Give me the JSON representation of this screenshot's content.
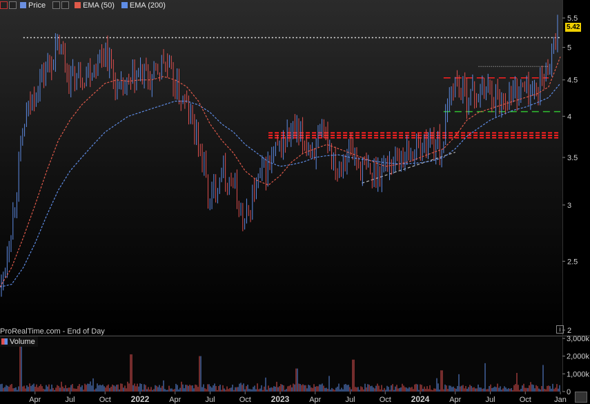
{
  "legend": {
    "price_label": "Price",
    "ema50_label": "EMA (50)",
    "ema200_label": "EMA (200)"
  },
  "credit": "ProRealTime.com - End of Day",
  "volume_label": "Volume",
  "last_value": "5.42",
  "colors": {
    "background": "#000000",
    "up_candle": "#5f8de6",
    "down_candle": "#e05050",
    "ema50": "#e05a4a",
    "ema200": "#5f8de6",
    "resistance": "#ff2020",
    "highlight": "#f0d000",
    "support_green": "#30c030"
  },
  "icons": {
    "window_buttons": [
      "close-icon",
      "minimize-icon",
      "list-icon",
      "maximize-icon"
    ],
    "info": "info-icon"
  },
  "chart_data": [
    {
      "type": "candlestick",
      "panel": "price",
      "series": [
        {
          "name": "Price"
        },
        {
          "name": "EMA (50)"
        },
        {
          "name": "EMA (200)"
        }
      ],
      "x_ticks": [
        "Apr",
        "Jul",
        "Oct",
        "2022",
        "Apr",
        "Jul",
        "Oct",
        "2023",
        "Apr",
        "Jul",
        "Oct",
        "2024",
        "Apr",
        "Jul",
        "Oct",
        "Jan"
      ],
      "y_ticks": [
        2,
        2.5,
        3,
        3.5,
        4,
        4.5,
        5,
        5.5
      ],
      "ylim": [
        2,
        5.6
      ],
      "y_scale": "log",
      "x": [
        "2021-01",
        "2021-02",
        "2021-03",
        "2021-04",
        "2021-05",
        "2021-06",
        "2021-07",
        "2021-08",
        "2021-09",
        "2021-10",
        "2021-11",
        "2021-12",
        "2022-01",
        "2022-02",
        "2022-03",
        "2022-04",
        "2022-05",
        "2022-06",
        "2022-07",
        "2022-08",
        "2022-09",
        "2022-10",
        "2022-11",
        "2022-12",
        "2023-01",
        "2023-02",
        "2023-03",
        "2023-04",
        "2023-05",
        "2023-06",
        "2023-07",
        "2023-08",
        "2023-09",
        "2023-10",
        "2023-11",
        "2023-12",
        "2024-01",
        "2024-02",
        "2024-03",
        "2024-04",
        "2024-05",
        "2024-06",
        "2024-07",
        "2024-08",
        "2024-09",
        "2024-10",
        "2024-11",
        "2024-12",
        "2025-01"
      ],
      "close": [
        2.3,
        2.9,
        3.9,
        4.4,
        4.7,
        5.0,
        4.5,
        4.6,
        4.7,
        5.0,
        4.3,
        4.4,
        4.6,
        4.5,
        4.8,
        4.4,
        4.1,
        3.7,
        3.0,
        3.4,
        3.2,
        2.8,
        3.2,
        3.4,
        3.6,
        3.8,
        3.7,
        3.6,
        3.75,
        3.4,
        3.6,
        3.4,
        3.3,
        3.4,
        3.5,
        3.55,
        3.6,
        3.7,
        3.6,
        4.5,
        4.3,
        4.3,
        4.4,
        4.2,
        4.3,
        4.4,
        4.3,
        4.6,
        5.3
      ],
      "ema50": [
        2.3,
        2.45,
        2.7,
        3.0,
        3.35,
        3.7,
        3.95,
        4.15,
        4.3,
        4.45,
        4.5,
        4.48,
        4.5,
        4.5,
        4.55,
        4.5,
        4.4,
        4.2,
        3.9,
        3.7,
        3.55,
        3.35,
        3.25,
        3.2,
        3.3,
        3.45,
        3.55,
        3.6,
        3.65,
        3.6,
        3.55,
        3.5,
        3.45,
        3.4,
        3.42,
        3.45,
        3.5,
        3.55,
        3.6,
        3.75,
        3.95,
        4.05,
        4.1,
        4.15,
        4.2,
        4.25,
        4.3,
        4.4,
        4.85
      ],
      "ema200": [
        2.3,
        2.32,
        2.45,
        2.65,
        2.9,
        3.15,
        3.35,
        3.5,
        3.65,
        3.8,
        3.9,
        4.0,
        4.05,
        4.1,
        4.15,
        4.2,
        4.2,
        4.15,
        4.05,
        3.9,
        3.8,
        3.65,
        3.55,
        3.45,
        3.4,
        3.42,
        3.45,
        3.5,
        3.52,
        3.53,
        3.5,
        3.48,
        3.46,
        3.44,
        3.43,
        3.43,
        3.44,
        3.46,
        3.5,
        3.6,
        3.75,
        3.85,
        3.95,
        4.02,
        4.08,
        4.12,
        4.18,
        4.25,
        4.45
      ],
      "levels": [
        5.16,
        3.79,
        3.76,
        3.73,
        4.53,
        4.06,
        4.7
      ]
    },
    {
      "type": "bar",
      "panel": "volume",
      "name": "Volume",
      "y_ticks": [
        "3,000k",
        "2,000k",
        "1,000k",
        "0"
      ],
      "ylim": [
        0,
        3000
      ]
    }
  ]
}
